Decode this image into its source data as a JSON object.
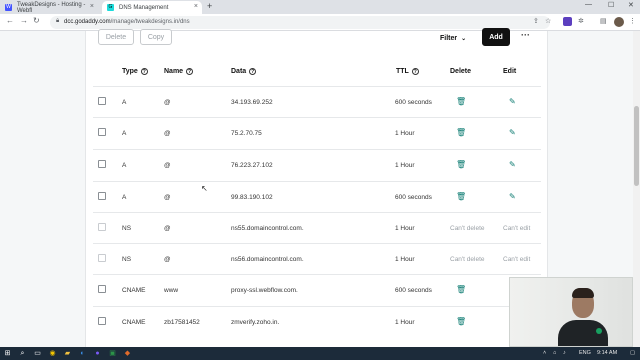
{
  "browser": {
    "tabs": [
      {
        "label": "TweakDesigns - Hosting - Webfl",
        "favicon": "W"
      },
      {
        "label": "DNS Management",
        "favicon": "G"
      }
    ],
    "new_tab": "+",
    "url_host": "dcc.godaddy.com",
    "url_path": "/manage/tweakdesigns.in/dns"
  },
  "toolbar": {
    "delete_label": "Delete",
    "copy_label": "Copy",
    "filter_label": "Filter",
    "add_label": "Add",
    "more_label": "···"
  },
  "table": {
    "headers": {
      "type": "Type",
      "name": "Name",
      "data": "Data",
      "ttl": "TTL",
      "delete": "Delete",
      "edit": "Edit"
    },
    "rows": [
      {
        "type": "A",
        "name": "@",
        "data": "34.193.69.252",
        "ttl": "600 seconds",
        "deletable": true,
        "delete_text": "",
        "edit_text": ""
      },
      {
        "type": "A",
        "name": "@",
        "data": "75.2.70.75",
        "ttl": "1 Hour",
        "deletable": true,
        "delete_text": "",
        "edit_text": ""
      },
      {
        "type": "A",
        "name": "@",
        "data": "76.223.27.102",
        "ttl": "1 Hour",
        "deletable": true,
        "delete_text": "",
        "edit_text": ""
      },
      {
        "type": "A",
        "name": "@",
        "data": "99.83.190.102",
        "ttl": "600 seconds",
        "deletable": true,
        "delete_text": "",
        "edit_text": ""
      },
      {
        "type": "NS",
        "name": "@",
        "data": "ns55.domaincontrol.com.",
        "ttl": "1 Hour",
        "deletable": false,
        "delete_text": "Can't delete",
        "edit_text": "Can't edit"
      },
      {
        "type": "NS",
        "name": "@",
        "data": "ns56.domaincontrol.com.",
        "ttl": "1 Hour",
        "deletable": false,
        "delete_text": "Can't delete",
        "edit_text": "Can't edit"
      },
      {
        "type": "CNAME",
        "name": "www",
        "data": "proxy-ssl.webflow.com.",
        "ttl": "600 seconds",
        "deletable": true,
        "delete_text": "",
        "edit_text": ""
      },
      {
        "type": "CNAME",
        "name": "zb17581452",
        "data": "zmverify.zoho.in.",
        "ttl": "1 Hour",
        "deletable": true,
        "delete_text": "",
        "edit_text": ""
      }
    ]
  },
  "taskbar": {
    "lang": "ENG",
    "time": "9:14 AM"
  },
  "colors": {
    "accent": "#0a7a70",
    "add_button": "#111111",
    "taskbar": "#1c2b3a"
  },
  "icons": {
    "delete": "trash-icon",
    "edit": "pencil-icon",
    "help": "help-circle-icon"
  }
}
